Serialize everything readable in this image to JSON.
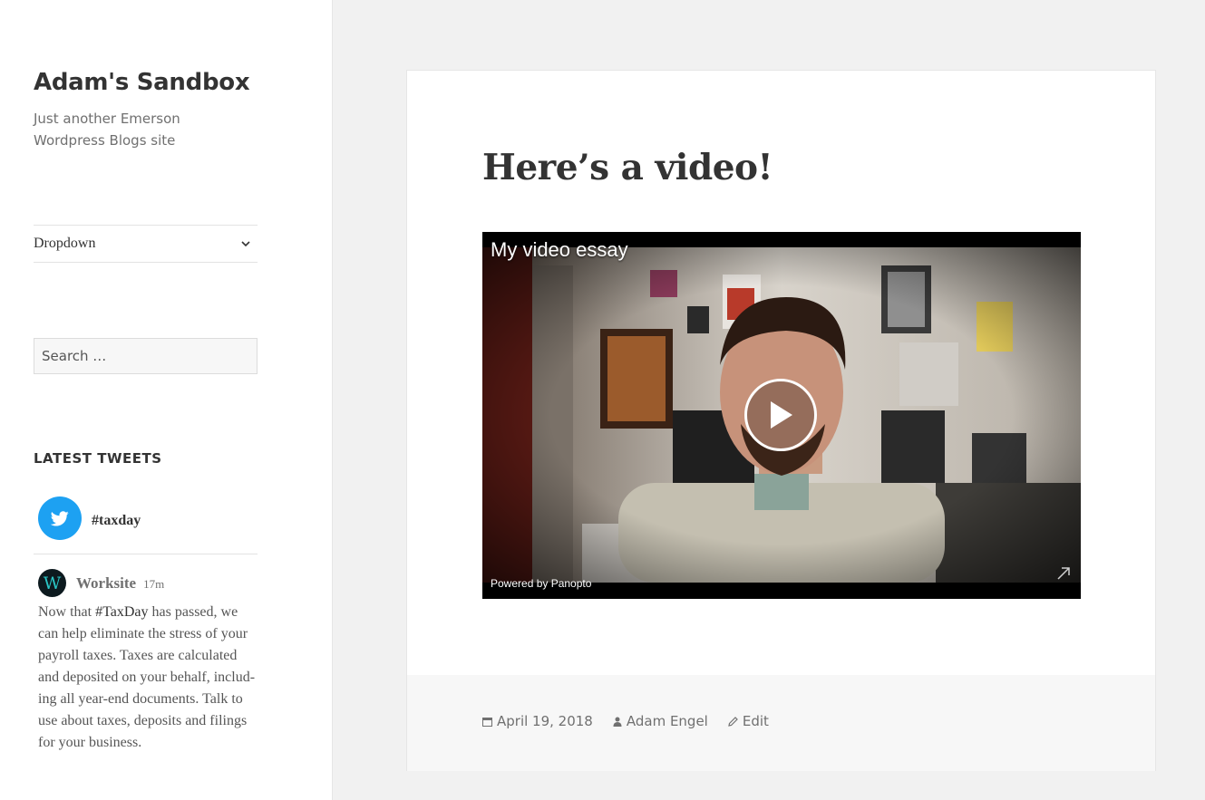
{
  "site": {
    "title": "Adam's Sandbox",
    "description": "Just another Emerson Wordpress Blogs site"
  },
  "sidebar": {
    "menu": {
      "label": "Dropdown"
    },
    "search": {
      "placeholder": "Search …"
    },
    "widget": {
      "title": "LATEST TWEETS",
      "hashtag": "#taxday",
      "tweet": {
        "avatar_letter": "W",
        "author": "Worksite",
        "time": "17m",
        "text_before": "Now that ",
        "tag": "#TaxDay",
        "text_after": " has passed, we can help eliminate the stress of your payroll taxes. Taxes are calculated and de­posited on your behalf, includ­ing all year-end documents. Talk to use about taxes, de­posits and filings for your busi­ness."
      }
    }
  },
  "post": {
    "title": "Here’s a video!",
    "video": {
      "title": "My video essay",
      "powered_by": "Powered by Panopto"
    },
    "meta": {
      "date": "April 19, 2018",
      "author": "Adam Engel",
      "edit": "Edit"
    }
  },
  "colors": {
    "twitter": "#1da1f2",
    "text": "#333333",
    "muted": "#707070",
    "page_bg": "#f1f1f1"
  },
  "icons": [
    "chevron-down-icon",
    "twitter-bird-icon",
    "play-icon",
    "expand-icon",
    "calendar-icon",
    "user-icon",
    "pencil-icon"
  ]
}
